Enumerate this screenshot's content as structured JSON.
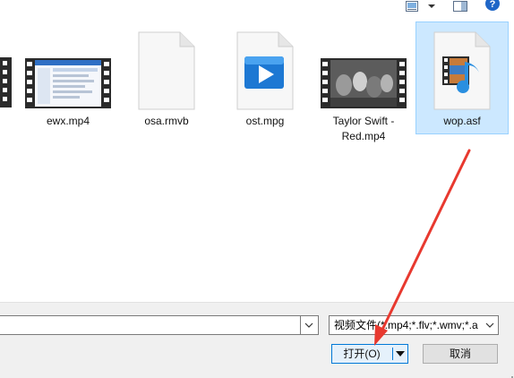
{
  "toolbar": {
    "icons": [
      "view-mode-icon",
      "chevron-down-icon",
      "preview-pane-icon",
      "help-icon"
    ],
    "help_label": "?"
  },
  "files": [
    {
      "name": "ewx.mp4",
      "type": "video-thumbnail",
      "selected": false
    },
    {
      "name": "osa.rmvb",
      "type": "blank-document",
      "selected": false
    },
    {
      "name": "ost.mpg",
      "type": "media-player-file",
      "selected": false
    },
    {
      "name": "Taylor Swift -\nRed.mp4",
      "type": "video-thumbnail",
      "selected": false
    },
    {
      "name": "wop.asf",
      "type": "media-audio-file",
      "selected": true
    }
  ],
  "bottom": {
    "filename_value": "",
    "filetype_selected": "视频文件(*.mp4;*.flv;*.wmv;*.a",
    "open_label": "打开(O)",
    "cancel_label": "取消"
  },
  "colors": {
    "selection_bg": "#cce8ff",
    "selection_border": "#99d1ff",
    "primary_button_border": "#0078d7",
    "annotation_arrow": "#e8392f"
  }
}
